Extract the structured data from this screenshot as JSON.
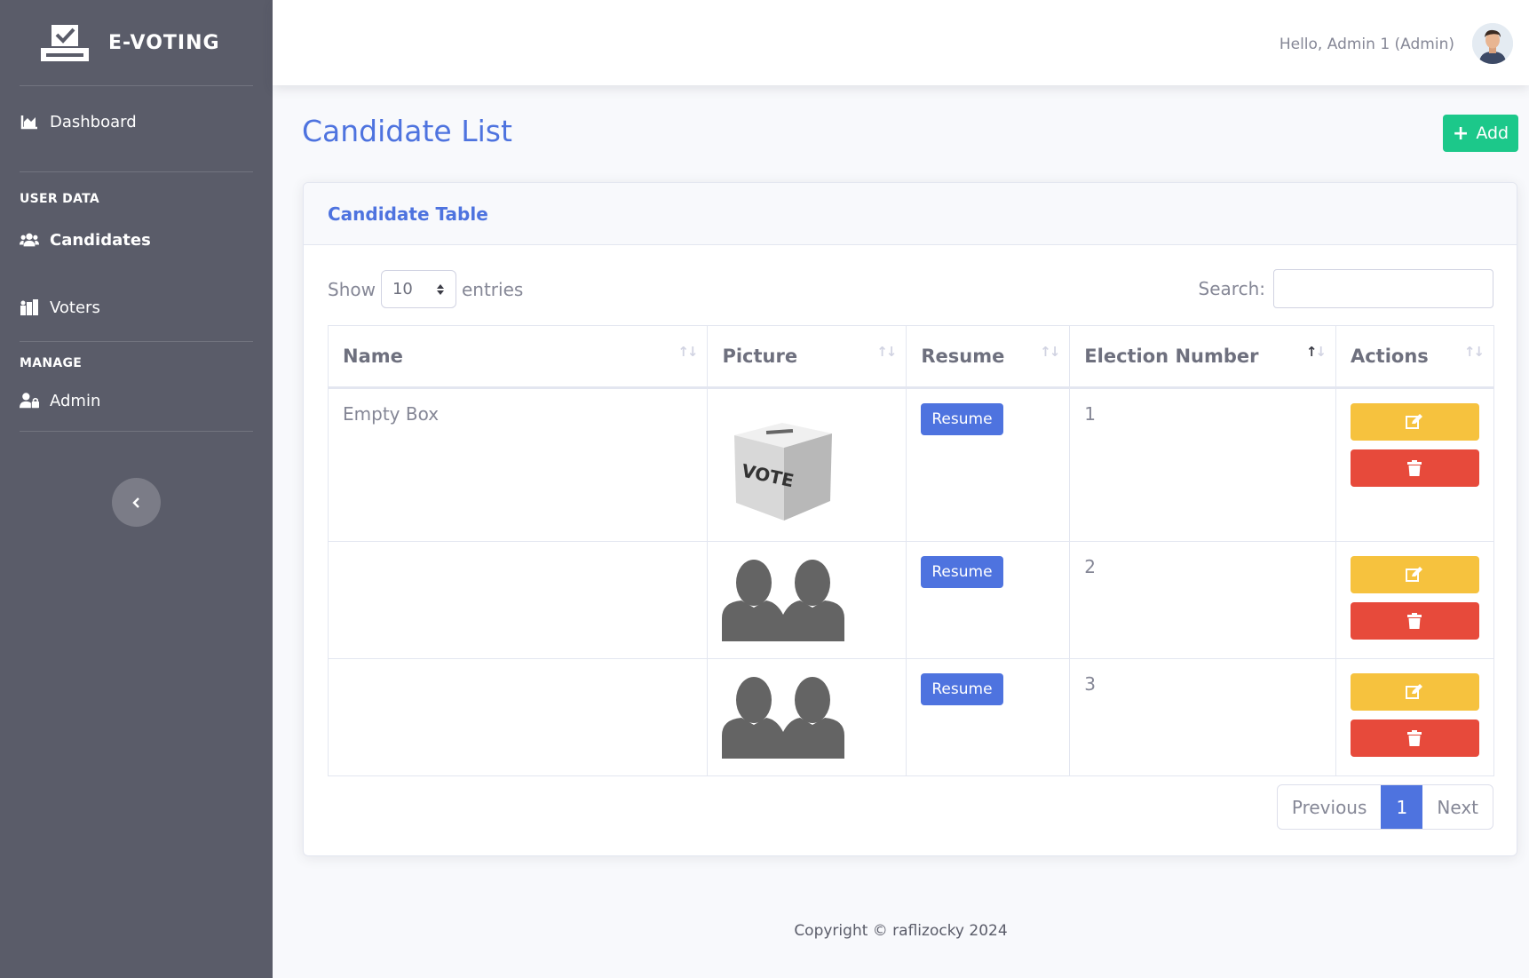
{
  "app": {
    "brand": "E-VOTING"
  },
  "sidebar": {
    "dashboard": "Dashboard",
    "heading_user_data": "USER DATA",
    "candidates": "Candidates",
    "voters": "Voters",
    "heading_manage": "MANAGE",
    "admin": "Admin"
  },
  "topbar": {
    "greeting": "Hello, Admin 1 (Admin)"
  },
  "page": {
    "title": "Candidate List",
    "add_label": "Add"
  },
  "card": {
    "title": "Candidate Table"
  },
  "table_controls": {
    "show_label": "Show",
    "entries_value": "10",
    "entries_label": "entries",
    "search_label": "Search:"
  },
  "table": {
    "headers": [
      "Name",
      "Picture",
      "Resume",
      "Election Number",
      "Actions"
    ],
    "rows": [
      {
        "name": "Empty Box",
        "picture": "vote-box-image",
        "resume_label": "Resume",
        "election_number": "1"
      },
      {
        "name": "",
        "picture": "silhouette-image",
        "resume_label": "Resume",
        "election_number": "2"
      },
      {
        "name": "",
        "picture": "silhouette-image",
        "resume_label": "Resume",
        "election_number": "3"
      }
    ]
  },
  "pagination": {
    "previous": "Previous",
    "current": "1",
    "next": "Next"
  },
  "footer": {
    "copyright": "Copyright © raflizocky 2024"
  },
  "icons": {
    "brand": "ballot-box-icon",
    "dashboard": "chart-area-icon",
    "candidates": "users-icon",
    "voters": "voters-icon",
    "admin": "user-lock-icon",
    "toggle": "chevron-left-icon",
    "edit": "edit-icon",
    "delete": "trash-icon",
    "add": "plus-icon"
  },
  "colors": {
    "sidebar": "#5a5c69",
    "primary": "#4e73df",
    "success": "#1cc88a",
    "warning": "#f6c23e",
    "danger": "#e74a3b"
  }
}
